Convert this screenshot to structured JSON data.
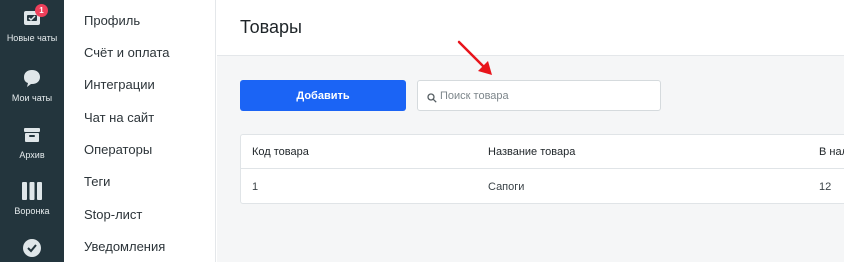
{
  "rail": {
    "items": [
      {
        "label": "Новые чаты",
        "icon": "new-chats-icon",
        "badge": "1"
      },
      {
        "label": "Мои чаты",
        "icon": "chat-bubble-icon"
      },
      {
        "label": "Архив",
        "icon": "archive-box-icon"
      },
      {
        "label": "Воронка",
        "icon": "funnel-columns-icon"
      },
      {
        "label": "",
        "icon": "check-circle-icon"
      }
    ]
  },
  "menu": {
    "items": [
      {
        "label": "Профиль"
      },
      {
        "label": "Счёт и оплата"
      },
      {
        "label": "Интеграции"
      },
      {
        "label": "Чат на сайт"
      },
      {
        "label": "Операторы"
      },
      {
        "label": "Теги"
      },
      {
        "label": "Stop-лист"
      },
      {
        "label": "Уведомления"
      }
    ]
  },
  "page": {
    "title": "Товары",
    "add_button": "Добавить",
    "search_placeholder": "Поиск товара",
    "search_value": ""
  },
  "table": {
    "columns": [
      "Код товара",
      "Название товара",
      "В нал"
    ],
    "rows": [
      [
        "1",
        "Сапоги",
        "12"
      ]
    ]
  },
  "colors": {
    "rail_bg": "#23353d",
    "accent": "#1b64f5",
    "badge": "#ee3f5a",
    "annotation_arrow": "#e8141b"
  }
}
